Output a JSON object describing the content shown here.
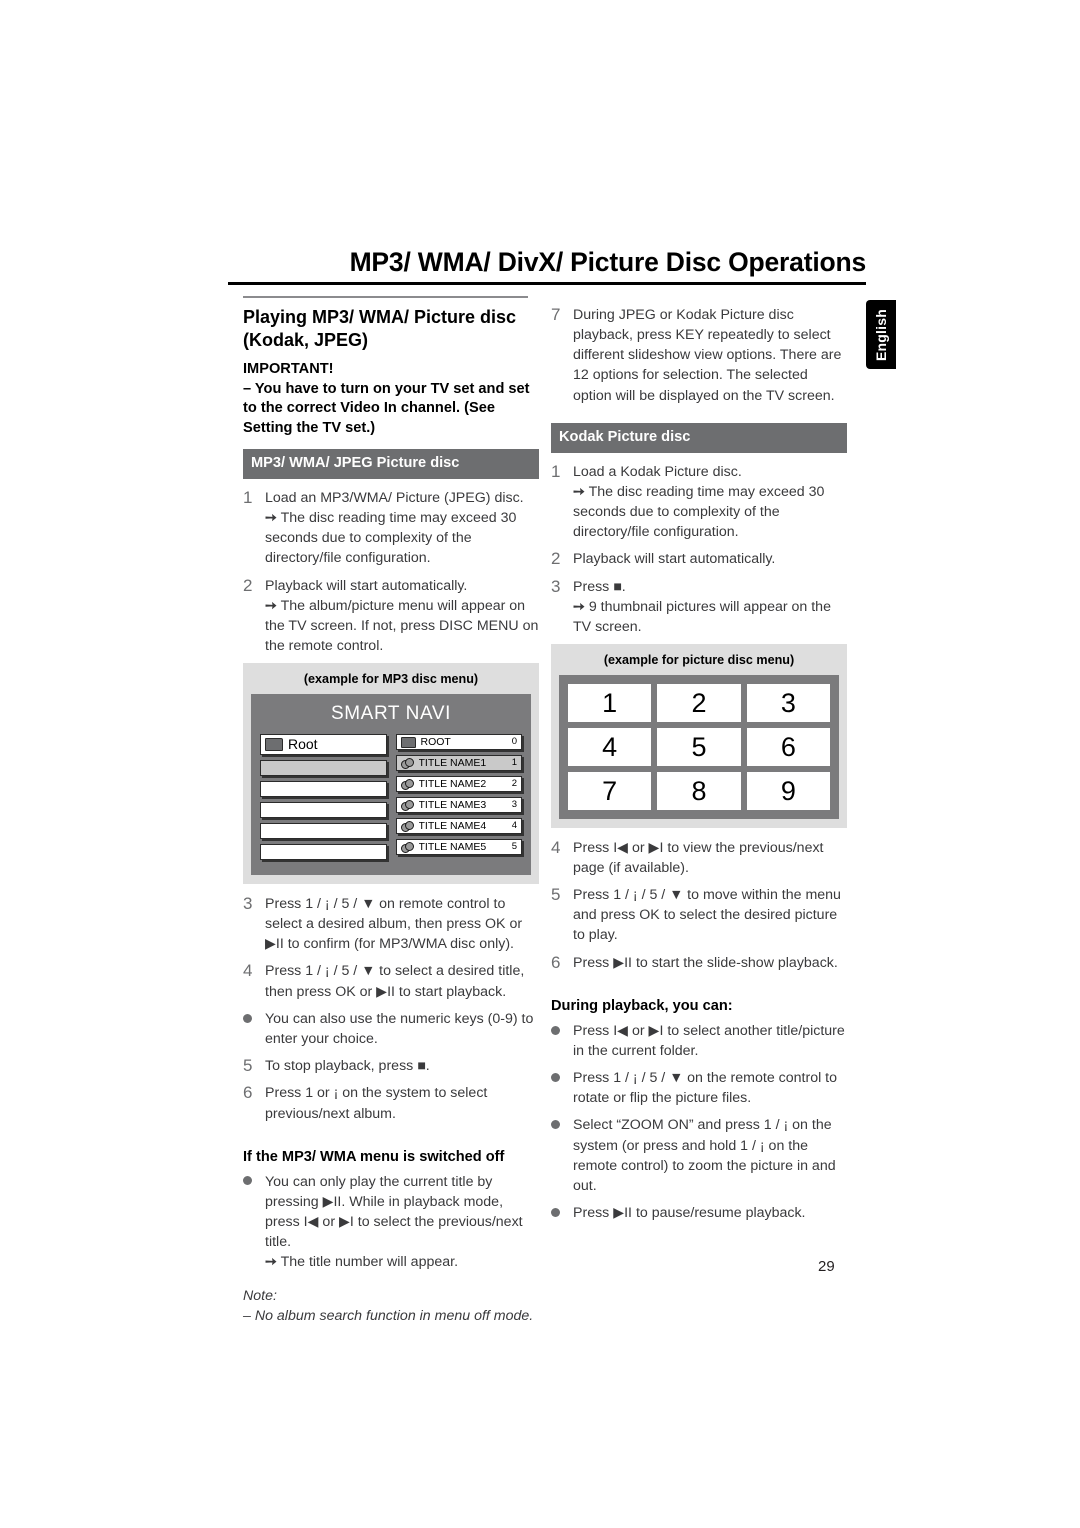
{
  "page": {
    "doc_title": "MP3/ WMA/ DivX/ Picture Disc Operations",
    "language_tab": "English",
    "page_number": "29"
  },
  "left_column": {
    "section_heading": "Playing MP3/ WMA/ Picture disc (Kodak, JPEG)",
    "important_label": "IMPORTANT!",
    "important_text": "–  You have to turn on your TV set and set to the correct Video In channel. (See Setting the TV set.)",
    "bar_mp3": "MP3/ WMA/ JPEG Picture disc",
    "steps": [
      {
        "num": "1",
        "text": "Load an MP3/WMA/ Picture (JPEG) disc.",
        "sub": "The disc reading time may exceed 30 seconds due to complexity of the directory/file configuration."
      },
      {
        "num": "2",
        "text": "Playback will start automatically.",
        "sub": "The album/picture menu will appear on the TV screen. If not, press DISC MENU on the remote control."
      }
    ],
    "steps_after_figure": [
      {
        "num": "3",
        "text": "Press 1 / ¡ / 5 / ▼ on remote control to select a desired album, then press OK or ▶II to confirm (for MP3/WMA disc only)."
      },
      {
        "num": "4",
        "text": "Press 1 / ¡ / 5 / ▼ to select a desired title, then press OK or ▶II to start playback."
      },
      {
        "num": "●",
        "text": "You can also use the numeric keys (0-9) to enter your choice."
      },
      {
        "num": "5",
        "text": "To stop playback, press ■."
      },
      {
        "num": "6",
        "text": "Press 1 or ¡ on the system to select previous/next album."
      }
    ],
    "menu_off": {
      "heading": "If the MP3/ WMA menu is switched off",
      "bullet": "You can only play the current title by pressing ▶II.  While in playback mode, press I◀ or ▶I to select the previous/next title.",
      "sub": "The title number will appear."
    },
    "note_label": "Note:",
    "note_text": "–  No album search function in menu off mode."
  },
  "mp3_figure": {
    "caption": "(example for MP3 disc menu)",
    "screen_title": "SMART NAVI",
    "left_list": [
      {
        "label": "Root",
        "icon": "folder-icon",
        "selected": false
      },
      {
        "label": "",
        "icon": "",
        "selected": true
      },
      {
        "label": "",
        "icon": "",
        "selected": false
      },
      {
        "label": "",
        "icon": "",
        "selected": false
      },
      {
        "label": "",
        "icon": "",
        "selected": false
      },
      {
        "label": "",
        "icon": "",
        "selected": false
      }
    ],
    "right_list": [
      {
        "label": "ROOT",
        "index": "0",
        "icon": "folder-icon",
        "selected": false
      },
      {
        "label": "TITLE NAME1",
        "index": "1",
        "icon": "disc-icon",
        "selected": true
      },
      {
        "label": "TITLE NAME2",
        "index": "2",
        "icon": "disc-icon",
        "selected": false
      },
      {
        "label": "TITLE NAME3",
        "index": "3",
        "icon": "disc-icon",
        "selected": false
      },
      {
        "label": "TITLE NAME4",
        "index": "4",
        "icon": "disc-icon",
        "selected": false
      },
      {
        "label": "TITLE NAME5",
        "index": "5",
        "icon": "disc-icon",
        "selected": false
      }
    ]
  },
  "right_column": {
    "step7": {
      "num": "7",
      "text": "During JPEG or Kodak Picture disc playback, press KEY repeatedly to select different slideshow view options. There are 12 options for selection. The selected option will be displayed on the TV screen."
    },
    "bar_kodak": "Kodak Picture disc",
    "steps": [
      {
        "num": "1",
        "text": "Load a Kodak Picture disc.",
        "sub": "The disc reading time may exceed 30 seconds due to complexity of the directory/file configuration."
      },
      {
        "num": "2",
        "text": "Playback will start automatically."
      },
      {
        "num": "3",
        "text": "Press ■.",
        "sub": "9 thumbnail pictures will appear on the TV screen."
      }
    ],
    "steps_after_figure": [
      {
        "num": "4",
        "text": "Press I◀ or ▶I to view the previous/next page (if available)."
      },
      {
        "num": "5",
        "text": "Press 1 / ¡ / 5 / ▼ to move within the menu and press OK to select the desired picture to play."
      },
      {
        "num": "6",
        "text": "Press ▶II to start the slide-show playback."
      }
    ],
    "during_playback": {
      "heading": "During playback, you can:",
      "bullets": [
        "Press I◀ or ▶I to select another title/picture in the current folder.",
        "Press 1 / ¡ / 5 / ▼ on the remote control to rotate or flip the picture files.",
        "Select “ZOOM ON” and press 1 / ¡ on the system (or press and hold 1 / ¡ on the remote control) to zoom the picture in and out.",
        "Press ▶II to pause/resume playback."
      ]
    }
  },
  "picture_figure": {
    "caption": "(example for picture disc menu)",
    "cells": [
      "1",
      "2",
      "3",
      "4",
      "5",
      "6",
      "7",
      "8",
      "9"
    ]
  }
}
